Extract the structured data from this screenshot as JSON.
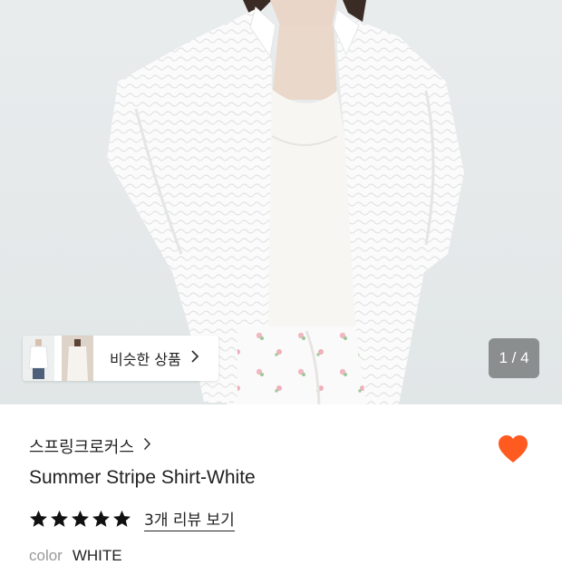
{
  "gallery": {
    "image_alt": "Summer Stripe Shirt-White product photo",
    "counter": "1 / 4",
    "similar_button_label": "비슷한 상품",
    "similar_button_icon": "chevron-right-icon"
  },
  "product": {
    "brand": "스프링크로커스",
    "brand_icon": "chevron-right-icon",
    "title": "Summer Stripe Shirt-White",
    "wishlisted": true,
    "heart_color": "#ff5a1f",
    "rating_stars": 5,
    "review_link": "3개 리뷰 보기",
    "color_label": "color",
    "color_value": "WHITE"
  }
}
